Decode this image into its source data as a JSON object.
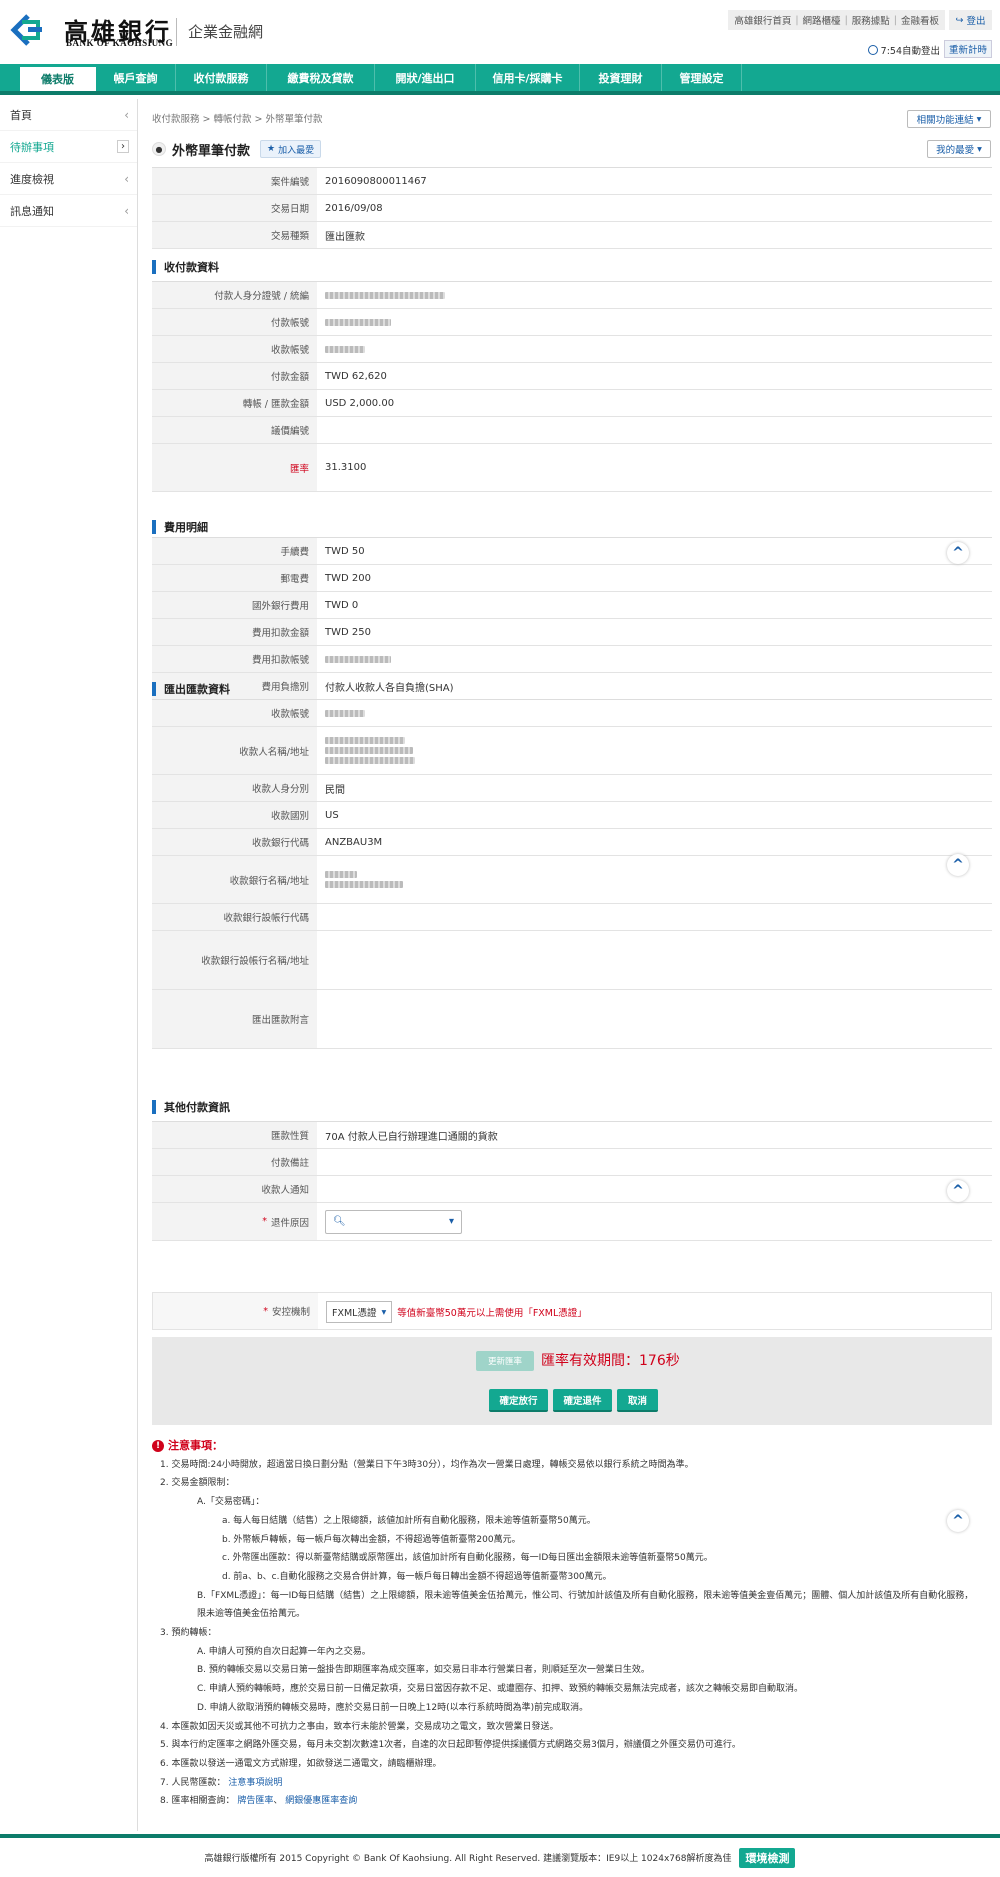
{
  "header": {
    "logo_cn": "高雄銀行",
    "logo_en": "BANK OF KAOHSIUNG",
    "subtitle": "企業金融網",
    "toplinks": [
      "高雄銀行首頁",
      "網路櫃檯",
      "服務據點",
      "金融看板"
    ],
    "logout": "登出",
    "timer": "7:54自動登出",
    "renew": "重新計時"
  },
  "nav": {
    "items": [
      "儀表版",
      "帳戶查詢",
      "收付款服務",
      "繳費稅及貸款",
      "開狀/進出口",
      "信用卡/採購卡",
      "投資理財",
      "管理設定"
    ]
  },
  "sidebar": {
    "items": [
      {
        "label": "首頁"
      },
      {
        "label": "待辦事項"
      },
      {
        "label": "進度檢視"
      },
      {
        "label": "訊息通知"
      }
    ]
  },
  "page": {
    "breadcrumb": "收付款服務 > 轉帳付款 > 外幣單筆付款",
    "related": "相關功能連結",
    "title": "外幣單筆付款",
    "add_fav": "加入最愛",
    "my_fav": "我的最愛"
  },
  "case": {
    "rows": [
      {
        "label": "案件編號",
        "value": "2016090800011467"
      },
      {
        "label": "交易日期",
        "value": "2016/09/08"
      },
      {
        "label": "交易種類",
        "value": "匯出匯款"
      }
    ]
  },
  "payment": {
    "title": "收付款資料",
    "payer_id_label": "付款人身分證號 / 統編",
    "payer_acct_label": "付款帳號",
    "payee_acct_label": "收款帳號",
    "amount_label": "付款金額",
    "amount_value": "TWD 62,620",
    "transfer_label": "轉帳 / 匯款金額",
    "transfer_value": "USD 2,000.00",
    "reserve_label": "議價編號",
    "rate_label": "匯率",
    "rate_value": "31.3100"
  },
  "fees": {
    "title": "費用明細",
    "rows": [
      {
        "label": "手續費",
        "value": "TWD 50"
      },
      {
        "label": "郵電費",
        "value": "TWD 200"
      },
      {
        "label": "國外銀行費用",
        "value": "TWD 0"
      },
      {
        "label": "費用扣款金額",
        "value": "TWD 250"
      },
      {
        "label": "費用扣款帳號",
        "value": ""
      },
      {
        "label": "費用負擔別",
        "value": "付款人收款人各自負擔(SHA)"
      }
    ]
  },
  "remit": {
    "title": "匯出匯款資料",
    "payee_acct_label": "收款帳號",
    "payee_name_label": "收款人名稱/地址",
    "payee_type_label": "收款人身分別",
    "payee_type_value": "民間",
    "country_label": "收款國別",
    "country_value": "US",
    "bank_code_label": "收款銀行代碼",
    "bank_code_value": "ANZBAU3M",
    "bank_name_label": "收款銀行名稱/地址",
    "inter_code_label": "收款銀行設帳行代碼",
    "inter_name_label": "收款銀行設帳行名稱/地址",
    "remark_label": "匯出匯款附言"
  },
  "other": {
    "title": "其他付款資訊",
    "nature_label": "匯款性質",
    "nature_value": "70A 付款人已自行辦理進口通關的貨款",
    "memo_label": "付款備註",
    "notify_label": "收款人通知",
    "reason_label": "退件原因"
  },
  "mechanism": {
    "label": "安控機制",
    "selected": "FXML憑證",
    "note": "等值新臺幣50萬元以上需使用「FXML憑證」"
  },
  "actions": {
    "refresh_rate": "更新匯率",
    "validity": "匯率有效期間：176秒",
    "approve": "確定放行",
    "reject": "確定退件",
    "cancel": "取消"
  },
  "notes": {
    "title": "注意事項：",
    "lines": [
      "1. 交易時間:24小時開放，超過當日換日劃分點（營業日下午3時30分），均作為次一營業日處理，轉帳交易依以銀行系統之時間為準。",
      "2. 交易金額限制：",
      "A.「交易密碼」：",
      "a. 每人每日結購（結售）之上限總額，該値加計所有自動化服務，限未逾等值新臺幣50萬元。",
      "b. 外幣帳戶轉帳，每一帳戶每次轉出金額，不得超過等值新臺幣200萬元。",
      "c. 外幣匯出匯款：得以新臺幣結購或原幣匯出，該值加計所有自動化服務，每一ID每日匯出金額限未逾等值新臺幣50萬元。",
      "d. 前a、b、c.自動化服務之交易合併計算，每一帳戶每日轉出金額不得超過等值新臺幣300萬元。",
      "B.「FXML憑證」：每一ID每日結購（結售）之上限總額，限未逾等值美金伍拾萬元，惟公司、行號加計該值及所有自動化服務，限未逾等值美金壹佰萬元；團體、個人加計該值及所有自動化服務，限未逾等值美金伍拾萬元。",
      "3. 預約轉帳：",
      "A. 申請人可預約自次日起算一年內之交易。",
      "B. 預約轉帳交易以交易日第一盤掛告即期匯率為成交匯率，如交易日非本行營業日者，則順延至次一營業日生效。",
      "C. 申請人預約轉帳時，應於交易日前一日備足款項，交易日當因存款不足、或遭圈存、扣押、致預約轉帳交易無法完成者，該次之轉帳交易即自動取消。",
      "D. 申請人欲取消預約轉帳交易時，應於交易日前一日晚上12時(以本行系統時間為準)前完成取消。",
      "4. 本匯款如因天災或其他不可抗力之事由，致本行未能於營業，交易成功之電文，致次營業日發送。",
      "5. 與本行約定匯率之網路外匯交易，每月未交割次數達1次者，自達的次日起即暫停提供採議價方式網路交易3個月，辦議價之外匯交易仍可進行。",
      "6. 本匯款以發送一通電文方式辦理，如欲發送二通電文，請臨櫃辦理。",
      "7. 人民幣匯款：",
      "8. 匯率相關查詢："
    ],
    "rmb_link": "注意事項說明",
    "rate_links": [
      "牌告匯率",
      "網銀優惠匯率查詢"
    ]
  },
  "footer": {
    "text": "高雄銀行版權所有 2015 Copyright © Bank Of Kaohsiung. All Right Reserved. 建議瀏覽版本：IE9以上 1024x768解析度為佳",
    "env_check": "環境檢測"
  }
}
